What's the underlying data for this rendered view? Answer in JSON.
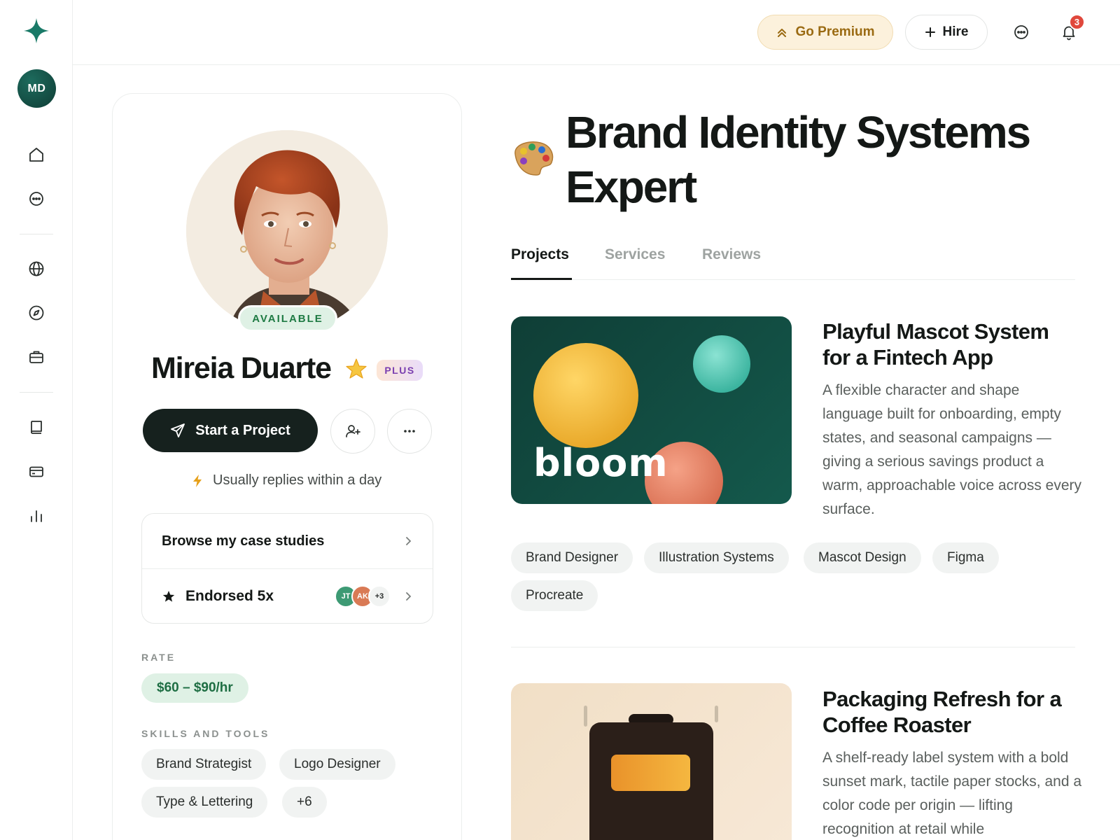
{
  "user": {
    "initials": "MD"
  },
  "sidebar": {
    "items": [
      {
        "icon": "home-icon"
      },
      {
        "icon": "chat-icon"
      },
      {
        "icon": "globe-icon"
      },
      {
        "icon": "compass-icon"
      },
      {
        "icon": "briefcase-icon"
      },
      {
        "icon": "book-icon"
      },
      {
        "icon": "credit-card-icon"
      },
      {
        "icon": "bar-chart-icon"
      }
    ]
  },
  "topbar": {
    "premium_label": "Go Premium",
    "hire_label": "Hire",
    "notification_count": "3"
  },
  "profile": {
    "status": "AVAILABLE",
    "name": "Mireia Duarte",
    "plan_badge": "PLUS",
    "start_label": "Start a Project",
    "reply_note": "Usually replies within a day",
    "case_studies_label": "Browse my case studies",
    "endorsed_label": "Endorsed 5x",
    "endorsers": [
      "JT",
      "AK"
    ],
    "endorsers_more": "+3",
    "rate_label": "RATE",
    "rate_value": "$60 – $90/hr",
    "skills_label": "SKILLS AND TOOLS",
    "skills": [
      "Brand Strategist",
      "Logo Designer",
      "Type & Lettering",
      "+6"
    ]
  },
  "main": {
    "headline": "Brand Identity Systems Expert",
    "tabs": [
      "Projects",
      "Services",
      "Reviews"
    ],
    "active_tab": "Projects",
    "projects": [
      {
        "title": "Playful Mascot System for a Fintech App",
        "description": "A flexible character and shape language built for onboarding, empty states, and seasonal campaigns — giving a serious savings product a warm, approachable voice across every surface.",
        "thumb_text": "bloom",
        "tags": [
          "Brand Designer",
          "Illustration Systems",
          "Mascot Design",
          "Figma",
          "Procreate"
        ]
      },
      {
        "title": "Packaging Refresh for a Coffee Roaster",
        "description": "A shelf-ready label system with a bold sunset mark, tactile paper stocks, and a color code per origin — lifting recognition at retail while"
      }
    ]
  },
  "colors": {
    "accent": "#1a7a68",
    "dark_button": "#16211e",
    "premium_bg": "#fcf1dc",
    "available_bg": "#dff1e5",
    "badge_red": "#e0483c"
  }
}
